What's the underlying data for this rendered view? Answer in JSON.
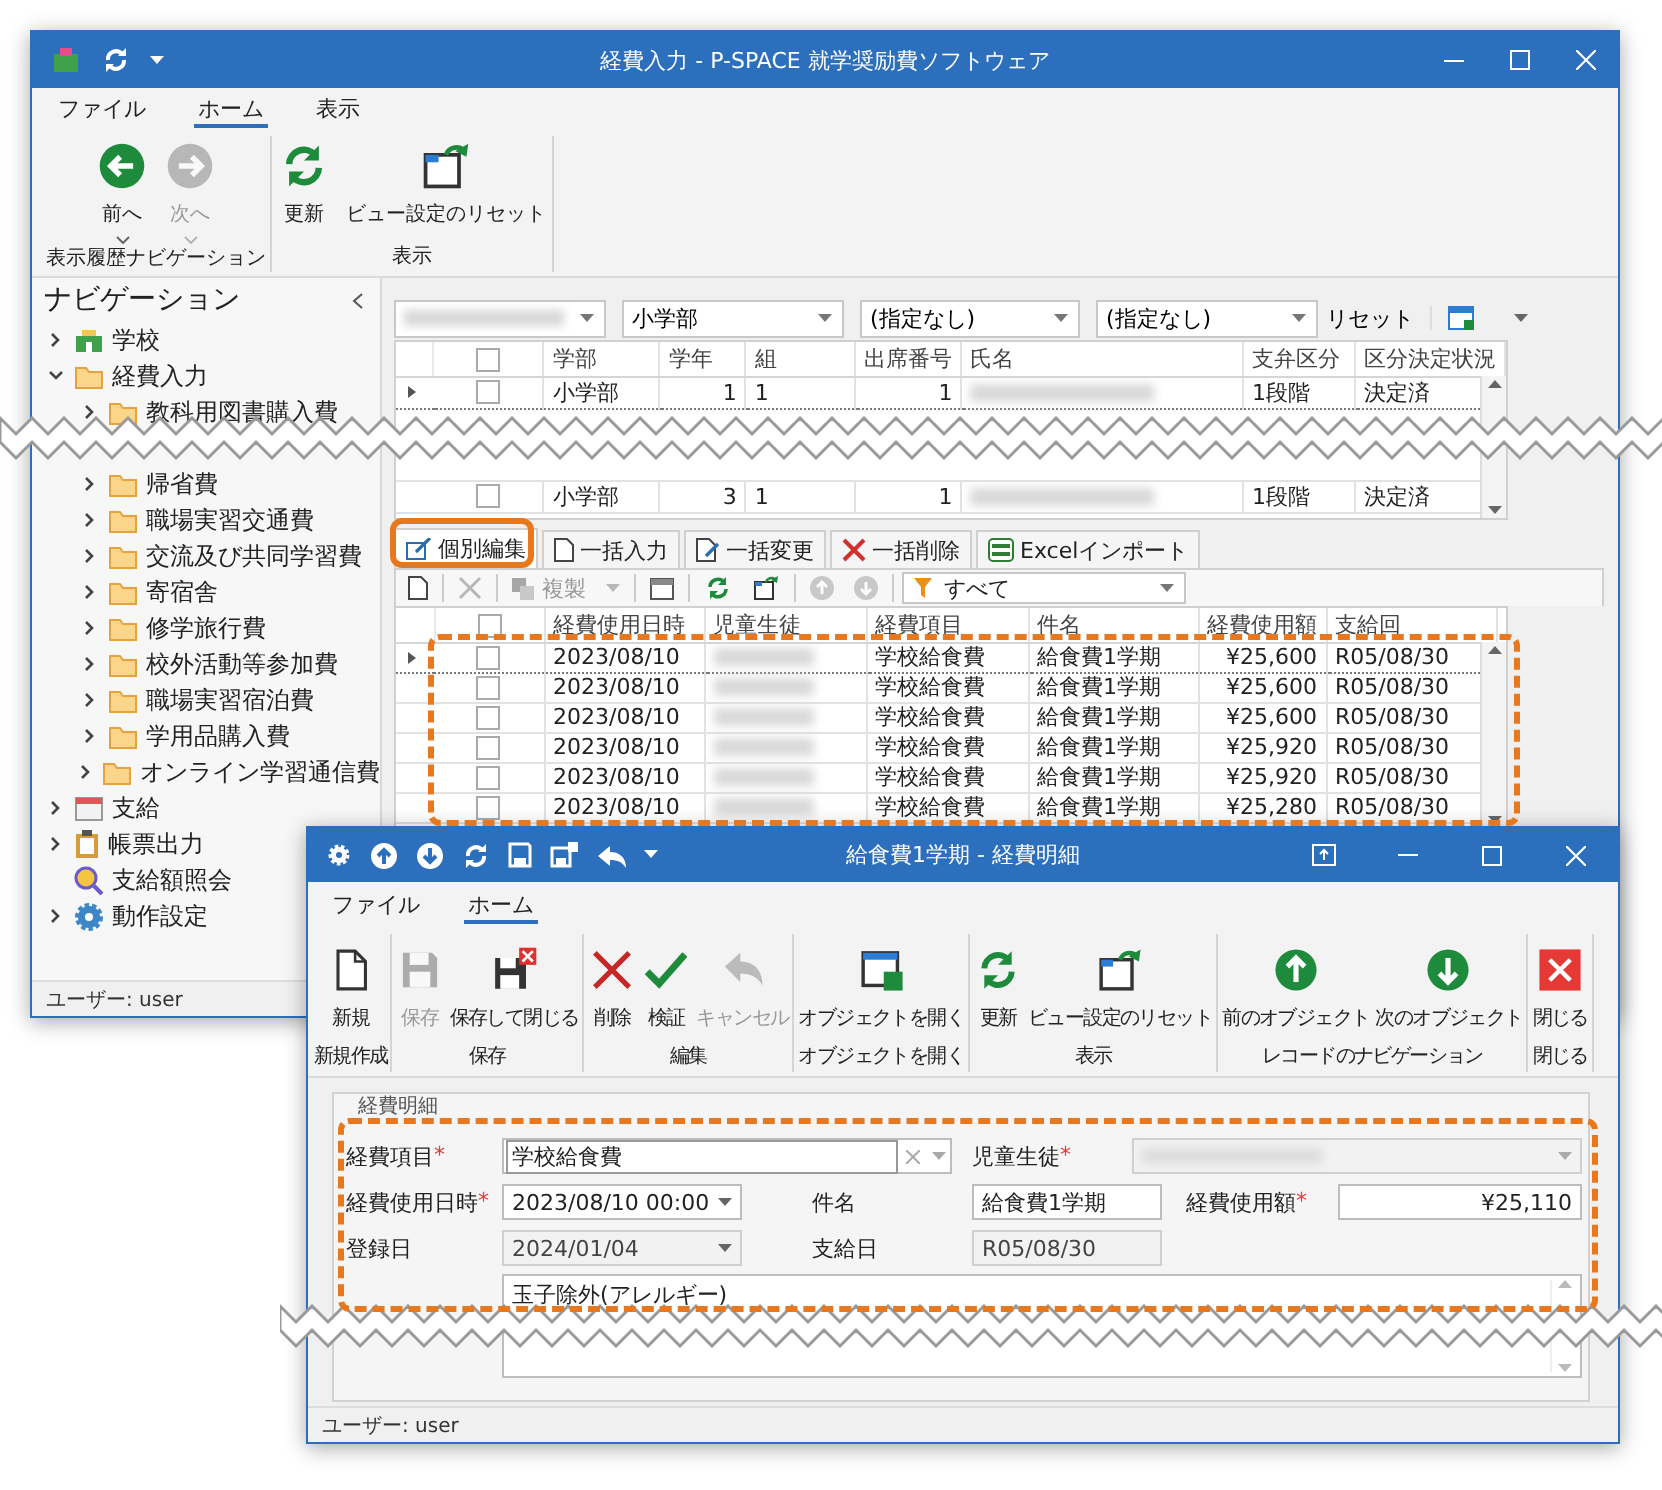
{
  "main_window": {
    "title": "経費入力 - P-SPACE 就学奨励費ソフトウェア",
    "ribbon_tabs": [
      {
        "label": "ファイル",
        "selected": false
      },
      {
        "label": "ホーム",
        "selected": true
      },
      {
        "label": "表示",
        "selected": false
      }
    ],
    "ribbon_groups": [
      {
        "label": "表示履歴ナビゲーション",
        "buttons": [
          {
            "label": "前へ",
            "disabled": false,
            "dropdown": true
          },
          {
            "label": "次へ",
            "disabled": true,
            "dropdown": true
          }
        ]
      },
      {
        "label": "表示",
        "buttons": [
          {
            "label": "更新",
            "disabled": false,
            "dropdown": false
          },
          {
            "label": "ビュー設定のリセット",
            "disabled": false,
            "dropdown": false
          }
        ]
      }
    ],
    "navigation": {
      "title": "ナビゲーション",
      "items": [
        {
          "label": "学校",
          "expanded": false
        },
        {
          "label": "経費入力",
          "expanded": true,
          "children": [
            {
              "label": "教科用図書購入費",
              "expanded": false
            },
            {
              "label": "帰省費",
              "expanded": false
            },
            {
              "label": "職場実習交通費",
              "expanded": false
            },
            {
              "label": "交流及び共同学習費",
              "expanded": false
            },
            {
              "label": "寄宿舎",
              "expanded": false
            },
            {
              "label": "修学旅行費",
              "expanded": false
            },
            {
              "label": "校外活動等参加費",
              "expanded": false
            },
            {
              "label": "職場実習宿泊費",
              "expanded": false
            },
            {
              "label": "学用品購入費",
              "expanded": false
            },
            {
              "label": "オンライン学習通信費",
              "expanded": false
            }
          ]
        },
        {
          "label": "支給",
          "expanded": false
        },
        {
          "label": "帳票出力",
          "expanded": false
        },
        {
          "label": "支給額照会"
        },
        {
          "label": "動作設定",
          "expanded": false
        }
      ]
    },
    "filters": [
      "小学部",
      "(指定なし)",
      "(指定なし)"
    ],
    "reset_link": "リセット",
    "student_grid": {
      "all_checked": false,
      "columns": [
        {
          "label": "学部"
        },
        {
          "label": "学年"
        },
        {
          "label": "組"
        },
        {
          "label": "出席番号"
        },
        {
          "label": "氏名"
        },
        {
          "label": "支弁区分"
        },
        {
          "label": "区分決定状況"
        }
      ],
      "rows": [
        {
          "selected": true,
          "checked": false,
          "cells": [
            "小学部",
            "1",
            "1",
            "1",
            "",
            "1段階",
            "決定済"
          ]
        },
        {
          "selected": false,
          "checked": false,
          "cells": [
            "小学部",
            "3",
            "1",
            "1",
            "",
            "1段階",
            "決定済"
          ]
        }
      ]
    },
    "edit_tabs": [
      {
        "label": "個別編集",
        "selected": true
      },
      {
        "label": "一括入力",
        "selected": false
      },
      {
        "label": "一括変更",
        "selected": false
      },
      {
        "label": "一括削除",
        "selected": false
      },
      {
        "label": "Excelインポート",
        "selected": false
      }
    ],
    "toolbar": {
      "copy": {
        "label": "複製",
        "disabled": true
      },
      "filter_value": "すべて"
    },
    "expense_grid": {
      "all_checked": false,
      "columns": [
        {
          "label": "経費使用日時"
        },
        {
          "label": "児童生徒"
        },
        {
          "label": "経費項目"
        },
        {
          "label": "件名"
        },
        {
          "label": "経費使用額"
        },
        {
          "label": "支給回"
        }
      ],
      "rows": [
        {
          "selected": true,
          "checked": false,
          "cells": [
            "2023/08/10",
            "",
            "学校給食費",
            "給食費1学期",
            "¥25,600",
            "R05/08/30"
          ]
        },
        {
          "selected": false,
          "checked": false,
          "cells": [
            "2023/08/10",
            "",
            "学校給食費",
            "給食費1学期",
            "¥25,600",
            "R05/08/30"
          ]
        },
        {
          "selected": false,
          "checked": false,
          "cells": [
            "2023/08/10",
            "",
            "学校給食費",
            "給食費1学期",
            "¥25,600",
            "R05/08/30"
          ]
        },
        {
          "selected": false,
          "checked": false,
          "cells": [
            "2023/08/10",
            "",
            "学校給食費",
            "給食費1学期",
            "¥25,920",
            "R05/08/30"
          ]
        },
        {
          "selected": false,
          "checked": false,
          "cells": [
            "2023/08/10",
            "",
            "学校給食費",
            "給食費1学期",
            "¥25,920",
            "R05/08/30"
          ]
        },
        {
          "selected": false,
          "checked": false,
          "cells": [
            "2023/08/10",
            "",
            "学校給食費",
            "給食費1学期",
            "¥25,280",
            "R05/08/30"
          ]
        }
      ]
    },
    "status_bar": "ユーザー: user"
  },
  "detail_window": {
    "title": "給食費1学期 - 経費明細",
    "ribbon_tabs": [
      {
        "label": "ファイル",
        "selected": false
      },
      {
        "label": "ホーム",
        "selected": true
      }
    ],
    "ribbon_groups": [
      {
        "label": "新規作成",
        "buttons": [
          {
            "label": "新規",
            "disabled": false
          }
        ]
      },
      {
        "label": "保存",
        "buttons": [
          {
            "label": "保存",
            "disabled": true
          },
          {
            "label": "保存して閉じる",
            "disabled": false
          }
        ]
      },
      {
        "label": "編集",
        "buttons": [
          {
            "label": "削除",
            "disabled": false
          },
          {
            "label": "検証",
            "disabled": false
          },
          {
            "label": "キャンセル",
            "disabled": true
          }
        ]
      },
      {
        "label": "オブジェクトを開く",
        "buttons": [
          {
            "label": "オブジェクトを開く",
            "disabled": false
          }
        ]
      },
      {
        "label": "表示",
        "buttons": [
          {
            "label": "更新",
            "disabled": false
          },
          {
            "label": "ビュー設定のリセット",
            "disabled": false
          }
        ]
      },
      {
        "label": "レコードのナビゲーション",
        "buttons": [
          {
            "label": "前のオブジェクト",
            "disabled": false
          },
          {
            "label": "次のオブジェクト",
            "disabled": false
          }
        ]
      },
      {
        "label": "閉じる",
        "buttons": [
          {
            "label": "閉じる",
            "disabled": false
          }
        ]
      }
    ],
    "form": {
      "title": "経費明細",
      "rows": [
        [
          {
            "kind": "lookup",
            "label": "経費項目",
            "required_mark": "*",
            "value": "学校給食費",
            "readonly": false
          },
          {
            "kind": "blurred",
            "label": "児童生徒",
            "required_mark": "*",
            "readonly": true
          }
        ],
        [
          {
            "kind": "date",
            "label": "経費使用日時",
            "required_mark": "*",
            "value": "2023/08/10 00:00",
            "readonly": false
          },
          {
            "kind": "text",
            "label": "件名",
            "value": "給食費1学期",
            "readonly": false
          },
          {
            "kind": "number",
            "label": "経費使用額",
            "required_mark": "*",
            "value": "¥25,110",
            "readonly": false
          }
        ],
        [
          {
            "kind": "date",
            "label": "登録日",
            "value": "2024/01/04",
            "readonly": true
          },
          {
            "kind": "text",
            "label": "支給日",
            "value": "R05/08/30",
            "readonly": true
          }
        ],
        [
          {
            "kind": "memo",
            "value": "玉子除外(アレルギー)",
            "readonly": false
          }
        ]
      ]
    },
    "status_bar": "ユーザー: user"
  }
}
